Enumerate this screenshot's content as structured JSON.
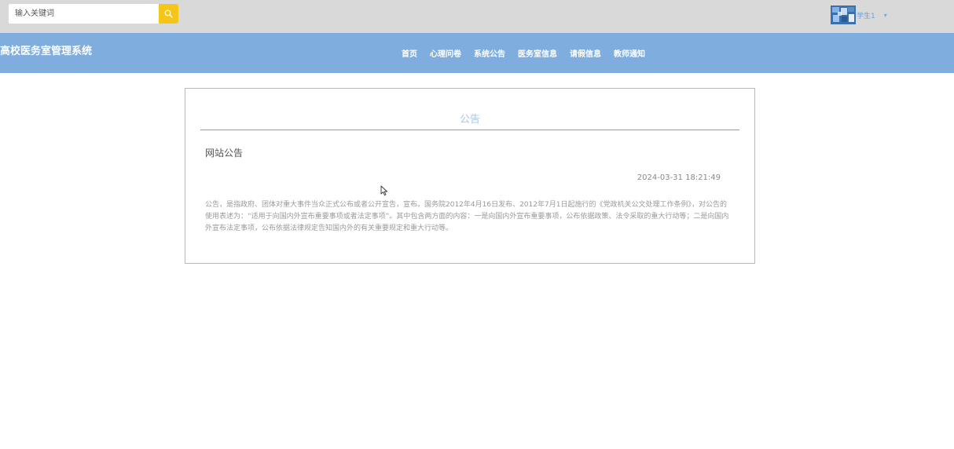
{
  "search": {
    "placeholder": "输入关键词",
    "value": ""
  },
  "user": {
    "name": "学生1"
  },
  "brand": {
    "title": "高校医务室管理系统"
  },
  "nav": {
    "items": [
      {
        "label": "首页"
      },
      {
        "label": "心理问卷"
      },
      {
        "label": "系统公告"
      },
      {
        "label": "医务室信息"
      },
      {
        "label": "请假信息"
      },
      {
        "label": "教师通知"
      }
    ]
  },
  "notice": {
    "heading": "公告",
    "title": "网站公告",
    "time": "2024-03-31 18:21:49",
    "body": "公告，是指政府、团体对重大事件当众正式公布或者公开宣告，宣布。国务院2012年4月16日发布、2012年7月1日起施行的《党政机关公文处理工作条例》，对公告的使用表述为：“适用于向国内外宣布重要事项或者法定事项”。其中包含两方面的内容：一是向国内外宣布重要事项，公布依据政策、法令采取的重大行动等；二是向国内外宣布法定事项，公布依据法律规定告知国内外的有关重要规定和重大行动等。"
  },
  "colors": {
    "topbar": "#d9d9d9",
    "navbar": "#7fadde",
    "search_button": "#f5c518",
    "heading": "#a9c5e6",
    "user_name": "#6a9fd8"
  },
  "icons": [
    "search-icon",
    "avatar-image",
    "caret-down-icon",
    "mouse-cursor-icon"
  ]
}
